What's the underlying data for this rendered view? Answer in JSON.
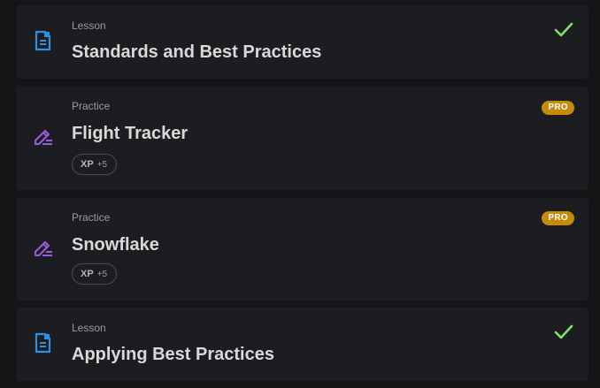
{
  "items": [
    {
      "kind": "Lesson",
      "title": "Standards and Best Practices",
      "icon": "document-icon",
      "status": "completed",
      "status_icon": "checkmark-icon"
    },
    {
      "kind": "Practice",
      "title": "Flight Tracker",
      "icon": "pencil-icon",
      "badge": "PRO",
      "xp_label": "XP",
      "xp_value": "+5"
    },
    {
      "kind": "Practice",
      "title": "Snowflake",
      "icon": "pencil-icon",
      "badge": "PRO",
      "xp_label": "XP",
      "xp_value": "+5"
    },
    {
      "kind": "Lesson",
      "title": "Applying Best Practices",
      "icon": "document-icon",
      "status": "completed",
      "status_icon": "checkmark-icon"
    }
  ],
  "colors": {
    "background": "#141517",
    "card": "#1c1d20",
    "lesson_icon": "#2f8fe0",
    "practice_icon": "#9a5de0",
    "check": "#7ee26a",
    "pro_badge": "#c68a0d"
  }
}
